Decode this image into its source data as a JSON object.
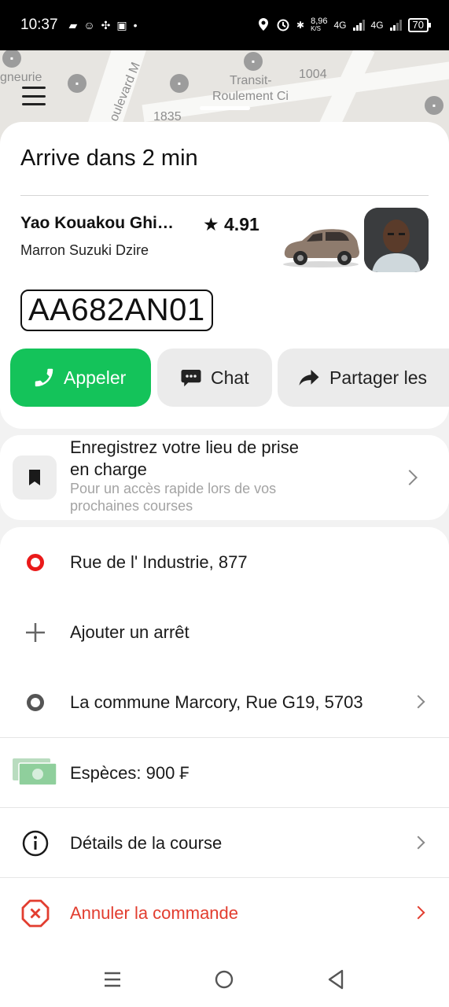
{
  "status_bar": {
    "time": "10:37",
    "net_speed_value": "8,96",
    "net_speed_unit": "K/S",
    "signal1": "4G",
    "signal2": "4G",
    "battery": "70"
  },
  "map": {
    "labels": [
      "gneurie",
      "oulevard M",
      "Transit-",
      "Roulement Ci",
      "1004",
      "1835"
    ]
  },
  "trip": {
    "eta": "Arrive dans 2 min",
    "driver_name": "Yao Kouakou Ghi…",
    "rating": "★ 4.91",
    "car_model": "Marron Suzuki Dzire",
    "plate": "AA682AN01"
  },
  "actions": {
    "call": "Appeler",
    "chat": "Chat",
    "share": "Partager les"
  },
  "save_pickup": {
    "title": "Enregistrez votre lieu de prise en charge",
    "subtitle": "Pour un accès rapide lors de vos prochaines courses"
  },
  "route": {
    "pickup": "Rue de l' Industrie, 877",
    "add_stop": "Ajouter un arrêt",
    "destination": "La commune Marcory, Rue G19, 5703"
  },
  "payment": {
    "label": "Espèces: 900 ₣"
  },
  "details": {
    "label": "Détails de la course"
  },
  "cancel": {
    "label": "Annuler la commande"
  },
  "colors": {
    "accent_green": "#14c35a",
    "danger_red": "#e23d2f",
    "pickup_red": "#ea1a1a"
  }
}
